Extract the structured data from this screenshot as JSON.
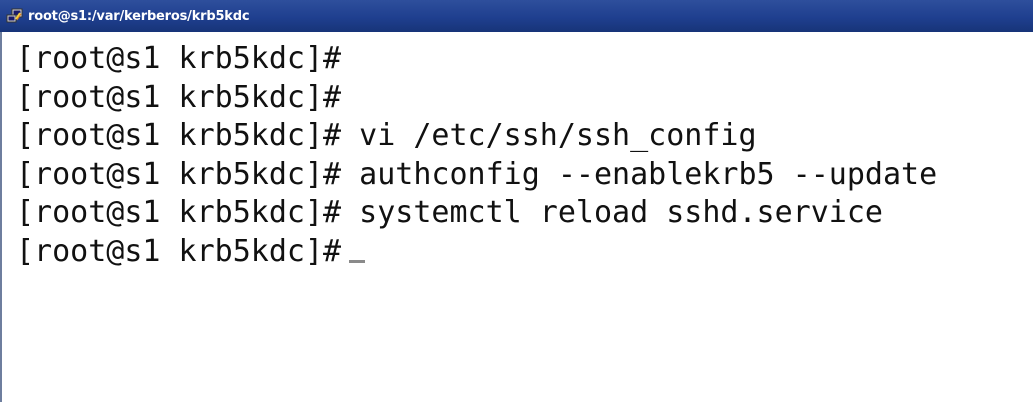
{
  "window": {
    "title": "root@s1:/var/kerberos/krb5kdc",
    "icon": "putty-icon"
  },
  "terminal": {
    "lines": [
      {
        "prompt": "[root@s1 krb5kdc]#",
        "command": ""
      },
      {
        "prompt": "[root@s1 krb5kdc]#",
        "command": ""
      },
      {
        "prompt": "[root@s1 krb5kdc]#",
        "command": " vi /etc/ssh/ssh_config"
      },
      {
        "prompt": "[root@s1 krb5kdc]#",
        "command": " authconfig --enablekrb5 --update"
      },
      {
        "prompt": "[root@s1 krb5kdc]#",
        "command": " systemctl reload sshd.service"
      },
      {
        "prompt": "[root@s1 krb5kdc]#",
        "command": ""
      }
    ],
    "cursor": "_"
  }
}
